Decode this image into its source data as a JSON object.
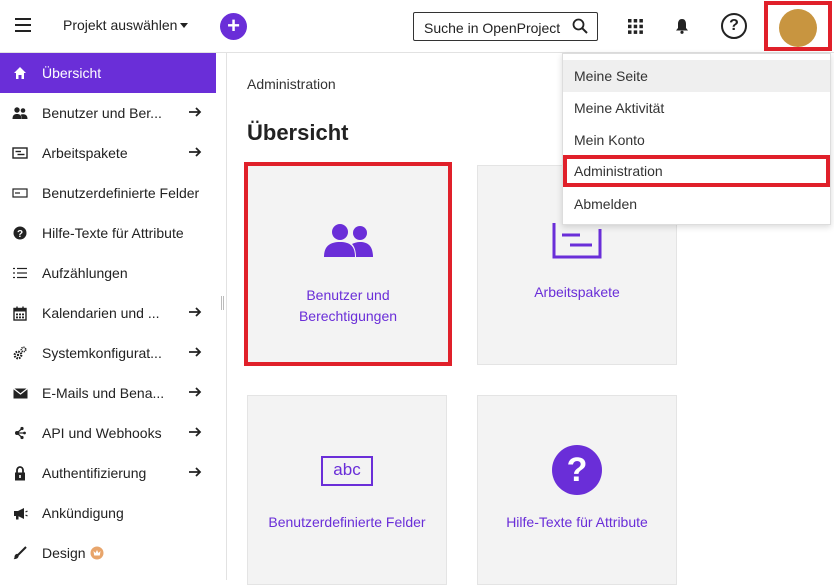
{
  "header": {
    "project_select": "Projekt auswählen",
    "plus": "+",
    "search_placeholder": "Suche in OpenProject",
    "help": "?"
  },
  "sidebar": {
    "items": [
      {
        "label": "Übersicht",
        "icon": "home-icon",
        "arrow": false,
        "active": true
      },
      {
        "label": "Benutzer und Ber...",
        "icon": "users-icon",
        "arrow": true
      },
      {
        "label": "Arbeitspakete",
        "icon": "work-packages-icon",
        "arrow": true
      },
      {
        "label": "Benutzerdefinierte Felder",
        "icon": "custom-fields-icon",
        "arrow": false
      },
      {
        "label": "Hilfe-Texte für Attribute",
        "icon": "help-circle-icon",
        "arrow": false
      },
      {
        "label": "Aufzählungen",
        "icon": "enumerations-icon",
        "arrow": false
      },
      {
        "label": "Kalendarien und ...",
        "icon": "calendar-icon",
        "arrow": true
      },
      {
        "label": "Systemkonfigurat...",
        "icon": "settings-icon",
        "arrow": true
      },
      {
        "label": "E-Mails und Bena...",
        "icon": "mail-icon",
        "arrow": true
      },
      {
        "label": "API und Webhooks",
        "icon": "api-icon",
        "arrow": true
      },
      {
        "label": "Authentifizierung",
        "icon": "lock-icon",
        "arrow": true
      },
      {
        "label": "Ankündigung",
        "icon": "megaphone-icon",
        "arrow": false
      },
      {
        "label": "Design",
        "icon": "brush-icon",
        "arrow": false
      }
    ]
  },
  "main": {
    "breadcrumb": "Administration",
    "title": "Übersicht",
    "tiles": [
      {
        "label_1": "Benutzer und",
        "label_2": "Berechtigungen"
      },
      {
        "label_1": "Arbeitspakete"
      },
      {
        "label_1": "Benutzerdefinierte Felder",
        "icon_text": "abc"
      },
      {
        "label_1": "Hilfe-Texte für Attribute",
        "icon_text": "?"
      }
    ]
  },
  "dropdown": {
    "items": [
      "Meine Seite",
      "Meine Aktivität",
      "Mein Konto",
      "Administration",
      "Abmelden"
    ]
  },
  "colors": {
    "accent": "#6a2ed8",
    "highlight": "#e0202a",
    "avatar": "#c89540"
  }
}
